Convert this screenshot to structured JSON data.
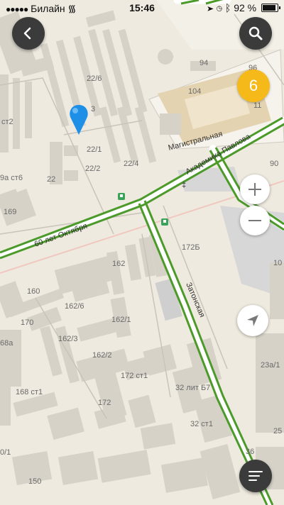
{
  "status_bar": {
    "carrier": "Билайн",
    "time": "15:46",
    "battery": "92 %"
  },
  "traffic_level": "6",
  "streets": {
    "oktyabrya": "60 лет Октября",
    "pavlova": "Академика Павлова",
    "magistralnaya": "Магистральная",
    "zatonskaya": "Затонская"
  },
  "building_labels": {
    "b22_6": "22/6",
    "b22_1": "22/1",
    "b22_2": "22/2",
    "b22_4": "22/4",
    "b22": "22",
    "b22_3": "3",
    "st2": "ст2",
    "b9a": "9а ст6",
    "b169": "169",
    "b94": "94",
    "b96": "96",
    "b104": "104",
    "b11": "11",
    "b90": "90",
    "b10": "10",
    "b172b": "172Б",
    "b162": "162",
    "b160": "160",
    "b162_6": "162/6",
    "b170": "170",
    "b162_1": "162/1",
    "b68a": "68а",
    "b162_3": "162/3",
    "b162_2": "162/2",
    "b172_st1": "172 ст1",
    "b168_st1": "168 ст1",
    "b32_lit": "32 лит Б7",
    "b172": "172",
    "b32_st1": "32 ст1",
    "b23a": "23а/1",
    "b25": "25",
    "b36": "36",
    "b0_1": "0/1",
    "b150": "150"
  },
  "icons": {
    "back": "back-arrow-icon",
    "search": "search-icon",
    "zoom_in": "plus-icon",
    "zoom_out": "minus-icon",
    "locate": "navigation-arrow-icon",
    "menu": "menu-lines-icon",
    "pin": "location-pin-icon"
  },
  "colors": {
    "map_bg": "#efeadf",
    "building": "#d6d2c8",
    "road_green": "#4c9a2a",
    "pin_blue": "#1e8fe6",
    "traffic_badge": "#f5b91a",
    "fab_dark": "#3b3b3b"
  }
}
